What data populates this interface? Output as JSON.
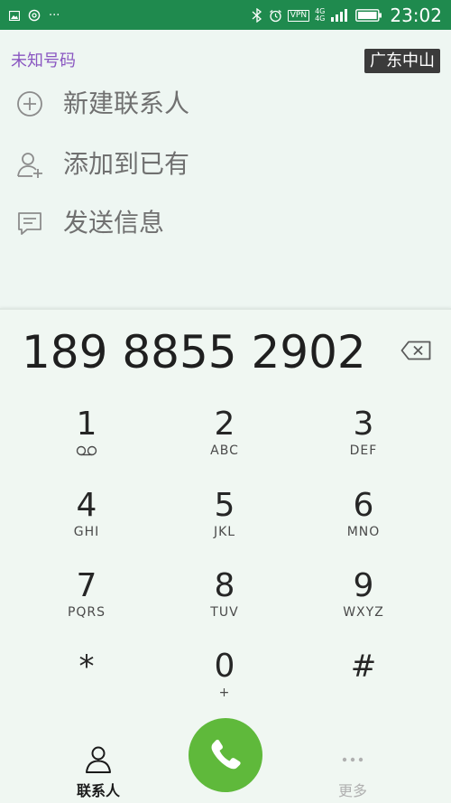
{
  "status_bar": {
    "time": "23:02",
    "vpn": "VPN",
    "net_top": "4G",
    "net_bottom": "4G",
    "more": "···"
  },
  "caller": {
    "unknown_label": "未知号码",
    "location": "广东中山"
  },
  "actions": [
    {
      "label": "新建联系人",
      "icon": "add-circle-icon"
    },
    {
      "label": "添加到已有",
      "icon": "add-person-icon"
    },
    {
      "label": "发送信息",
      "icon": "message-icon"
    }
  ],
  "dialer": {
    "number": "189 8855 2902",
    "keys": [
      {
        "digit": "1",
        "letters": ""
      },
      {
        "digit": "2",
        "letters": "ABC"
      },
      {
        "digit": "3",
        "letters": "DEF"
      },
      {
        "digit": "4",
        "letters": "GHI"
      },
      {
        "digit": "5",
        "letters": "JKL"
      },
      {
        "digit": "6",
        "letters": "MNO"
      },
      {
        "digit": "7",
        "letters": "PQRS"
      },
      {
        "digit": "8",
        "letters": "TUV"
      },
      {
        "digit": "9",
        "letters": "WXYZ"
      },
      {
        "digit": "*",
        "letters": ""
      },
      {
        "digit": "0",
        "letters": "+"
      },
      {
        "digit": "#",
        "letters": ""
      }
    ]
  },
  "bottom_bar": {
    "contacts_label": "联系人",
    "more_label": "更多"
  },
  "colors": {
    "status_bar": "#1f8a4e",
    "background": "#eef6f2",
    "call_button": "#5fb93b",
    "unknown_label": "#8a57c1"
  }
}
